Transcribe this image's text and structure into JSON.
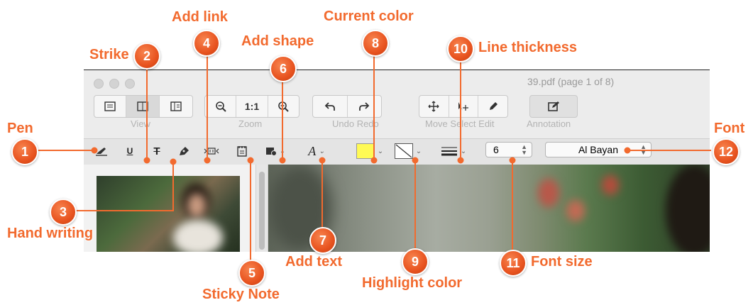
{
  "window": {
    "title": "39.pdf (page 1 of 8)",
    "groups": {
      "view": "View",
      "zoom": "Zoom",
      "undo_redo": "Undo Redo",
      "move_select_edit": "Move Select Edit",
      "annotation": "Annotation"
    },
    "zoom_actual": "1:1"
  },
  "toolbar": {
    "font_size": "6",
    "font_name": "Al Bayan",
    "current_color": "#fffa55",
    "text_tool": "A"
  },
  "callouts": {
    "c1": {
      "num": "1",
      "label": "Pen"
    },
    "c2": {
      "num": "2",
      "label": "Strike"
    },
    "c3": {
      "num": "3",
      "label": "Hand writing"
    },
    "c4": {
      "num": "4",
      "label": "Add link"
    },
    "c5": {
      "num": "5",
      "label": "Sticky Note"
    },
    "c6": {
      "num": "6",
      "label": "Add shape"
    },
    "c7": {
      "num": "7",
      "label": "Add text"
    },
    "c8": {
      "num": "8",
      "label": "Current color"
    },
    "c9": {
      "num": "9",
      "label": "Highlight color"
    },
    "c10": {
      "num": "10",
      "label": "Line thickness"
    },
    "c11": {
      "num": "11",
      "label": "Font size"
    },
    "c12": {
      "num": "12",
      "label": "Font"
    }
  },
  "icons": [
    "pen-icon",
    "underline-icon",
    "strike-icon",
    "handwriting-icon",
    "link-icon",
    "sticky-note-icon",
    "shape-icon",
    "text-icon",
    "line-thickness-icon",
    "zoom-out-icon",
    "zoom-in-icon",
    "undo-icon",
    "redo-icon",
    "move-icon",
    "select-icon",
    "edit-icon",
    "annotation-icon"
  ],
  "accent": "#f26a2e"
}
